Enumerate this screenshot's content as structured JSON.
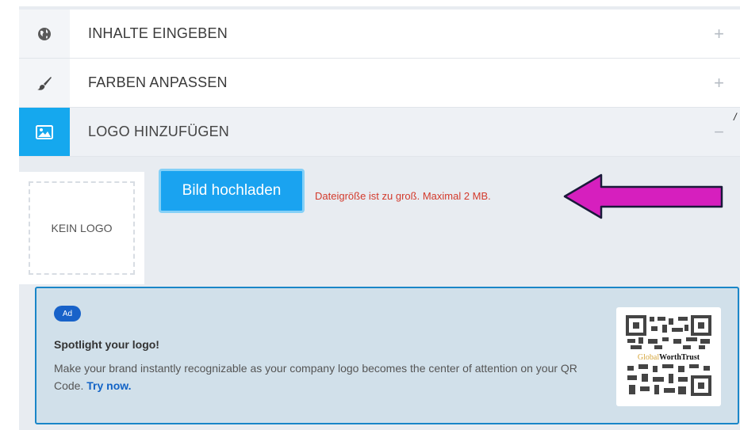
{
  "accordion": {
    "items": [
      {
        "label": "INHALTE EINGEBEN",
        "icon": "globe-icon",
        "toggle": "+",
        "state": "collapsed"
      },
      {
        "label": "FARBEN ANPASSEN",
        "icon": "paintbrush-icon",
        "toggle": "+",
        "state": "collapsed"
      },
      {
        "label": "LOGO HINZUFÜGEN",
        "icon": "image-icon",
        "toggle": "−",
        "state": "expanded"
      }
    ]
  },
  "logo_upload": {
    "placeholder": "KEIN LOGO",
    "button_label": "Bild hochladen",
    "error_message": "Dateigröße ist zu groß. Maximal 2 MB."
  },
  "annotation_arrow": {
    "color": "#d61fbe"
  },
  "ad": {
    "badge": "Ad",
    "title": "Spotlight your logo!",
    "body": "Make your brand instantly recognizable as your company logo becomes the center of attention on your QR Code.",
    "link": "Try now.",
    "qr_brand_part1": "Global",
    "qr_brand_part2": "WorthTrust"
  },
  "colors": {
    "accent": "#15a8ee",
    "error": "#d33a2c",
    "ad_border": "#1a86c8",
    "ad_background": "#d1e0ea"
  }
}
